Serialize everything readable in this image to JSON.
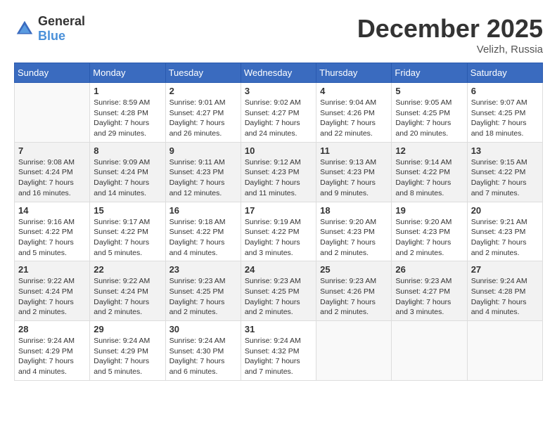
{
  "header": {
    "logo_general": "General",
    "logo_blue": "Blue",
    "month_title": "December 2025",
    "location": "Velizh, Russia"
  },
  "days_of_week": [
    "Sunday",
    "Monday",
    "Tuesday",
    "Wednesday",
    "Thursday",
    "Friday",
    "Saturday"
  ],
  "weeks": [
    [
      {
        "day": "",
        "sunrise": "",
        "sunset": "",
        "daylight": ""
      },
      {
        "day": "1",
        "sunrise": "Sunrise: 8:59 AM",
        "sunset": "Sunset: 4:28 PM",
        "daylight": "Daylight: 7 hours and 29 minutes."
      },
      {
        "day": "2",
        "sunrise": "Sunrise: 9:01 AM",
        "sunset": "Sunset: 4:27 PM",
        "daylight": "Daylight: 7 hours and 26 minutes."
      },
      {
        "day": "3",
        "sunrise": "Sunrise: 9:02 AM",
        "sunset": "Sunset: 4:27 PM",
        "daylight": "Daylight: 7 hours and 24 minutes."
      },
      {
        "day": "4",
        "sunrise": "Sunrise: 9:04 AM",
        "sunset": "Sunset: 4:26 PM",
        "daylight": "Daylight: 7 hours and 22 minutes."
      },
      {
        "day": "5",
        "sunrise": "Sunrise: 9:05 AM",
        "sunset": "Sunset: 4:25 PM",
        "daylight": "Daylight: 7 hours and 20 minutes."
      },
      {
        "day": "6",
        "sunrise": "Sunrise: 9:07 AM",
        "sunset": "Sunset: 4:25 PM",
        "daylight": "Daylight: 7 hours and 18 minutes."
      }
    ],
    [
      {
        "day": "7",
        "sunrise": "Sunrise: 9:08 AM",
        "sunset": "Sunset: 4:24 PM",
        "daylight": "Daylight: 7 hours and 16 minutes."
      },
      {
        "day": "8",
        "sunrise": "Sunrise: 9:09 AM",
        "sunset": "Sunset: 4:24 PM",
        "daylight": "Daylight: 7 hours and 14 minutes."
      },
      {
        "day": "9",
        "sunrise": "Sunrise: 9:11 AM",
        "sunset": "Sunset: 4:23 PM",
        "daylight": "Daylight: 7 hours and 12 minutes."
      },
      {
        "day": "10",
        "sunrise": "Sunrise: 9:12 AM",
        "sunset": "Sunset: 4:23 PM",
        "daylight": "Daylight: 7 hours and 11 minutes."
      },
      {
        "day": "11",
        "sunrise": "Sunrise: 9:13 AM",
        "sunset": "Sunset: 4:23 PM",
        "daylight": "Daylight: 7 hours and 9 minutes."
      },
      {
        "day": "12",
        "sunrise": "Sunrise: 9:14 AM",
        "sunset": "Sunset: 4:22 PM",
        "daylight": "Daylight: 7 hours and 8 minutes."
      },
      {
        "day": "13",
        "sunrise": "Sunrise: 9:15 AM",
        "sunset": "Sunset: 4:22 PM",
        "daylight": "Daylight: 7 hours and 7 minutes."
      }
    ],
    [
      {
        "day": "14",
        "sunrise": "Sunrise: 9:16 AM",
        "sunset": "Sunset: 4:22 PM",
        "daylight": "Daylight: 7 hours and 5 minutes."
      },
      {
        "day": "15",
        "sunrise": "Sunrise: 9:17 AM",
        "sunset": "Sunset: 4:22 PM",
        "daylight": "Daylight: 7 hours and 5 minutes."
      },
      {
        "day": "16",
        "sunrise": "Sunrise: 9:18 AM",
        "sunset": "Sunset: 4:22 PM",
        "daylight": "Daylight: 7 hours and 4 minutes."
      },
      {
        "day": "17",
        "sunrise": "Sunrise: 9:19 AM",
        "sunset": "Sunset: 4:22 PM",
        "daylight": "Daylight: 7 hours and 3 minutes."
      },
      {
        "day": "18",
        "sunrise": "Sunrise: 9:20 AM",
        "sunset": "Sunset: 4:23 PM",
        "daylight": "Daylight: 7 hours and 2 minutes."
      },
      {
        "day": "19",
        "sunrise": "Sunrise: 9:20 AM",
        "sunset": "Sunset: 4:23 PM",
        "daylight": "Daylight: 7 hours and 2 minutes."
      },
      {
        "day": "20",
        "sunrise": "Sunrise: 9:21 AM",
        "sunset": "Sunset: 4:23 PM",
        "daylight": "Daylight: 7 hours and 2 minutes."
      }
    ],
    [
      {
        "day": "21",
        "sunrise": "Sunrise: 9:22 AM",
        "sunset": "Sunset: 4:24 PM",
        "daylight": "Daylight: 7 hours and 2 minutes."
      },
      {
        "day": "22",
        "sunrise": "Sunrise: 9:22 AM",
        "sunset": "Sunset: 4:24 PM",
        "daylight": "Daylight: 7 hours and 2 minutes."
      },
      {
        "day": "23",
        "sunrise": "Sunrise: 9:23 AM",
        "sunset": "Sunset: 4:25 PM",
        "daylight": "Daylight: 7 hours and 2 minutes."
      },
      {
        "day": "24",
        "sunrise": "Sunrise: 9:23 AM",
        "sunset": "Sunset: 4:25 PM",
        "daylight": "Daylight: 7 hours and 2 minutes."
      },
      {
        "day": "25",
        "sunrise": "Sunrise: 9:23 AM",
        "sunset": "Sunset: 4:26 PM",
        "daylight": "Daylight: 7 hours and 2 minutes."
      },
      {
        "day": "26",
        "sunrise": "Sunrise: 9:23 AM",
        "sunset": "Sunset: 4:27 PM",
        "daylight": "Daylight: 7 hours and 3 minutes."
      },
      {
        "day": "27",
        "sunrise": "Sunrise: 9:24 AM",
        "sunset": "Sunset: 4:28 PM",
        "daylight": "Daylight: 7 hours and 4 minutes."
      }
    ],
    [
      {
        "day": "28",
        "sunrise": "Sunrise: 9:24 AM",
        "sunset": "Sunset: 4:29 PM",
        "daylight": "Daylight: 7 hours and 4 minutes."
      },
      {
        "day": "29",
        "sunrise": "Sunrise: 9:24 AM",
        "sunset": "Sunset: 4:29 PM",
        "daylight": "Daylight: 7 hours and 5 minutes."
      },
      {
        "day": "30",
        "sunrise": "Sunrise: 9:24 AM",
        "sunset": "Sunset: 4:30 PM",
        "daylight": "Daylight: 7 hours and 6 minutes."
      },
      {
        "day": "31",
        "sunrise": "Sunrise: 9:24 AM",
        "sunset": "Sunset: 4:32 PM",
        "daylight": "Daylight: 7 hours and 7 minutes."
      },
      {
        "day": "",
        "sunrise": "",
        "sunset": "",
        "daylight": ""
      },
      {
        "day": "",
        "sunrise": "",
        "sunset": "",
        "daylight": ""
      },
      {
        "day": "",
        "sunrise": "",
        "sunset": "",
        "daylight": ""
      }
    ]
  ]
}
